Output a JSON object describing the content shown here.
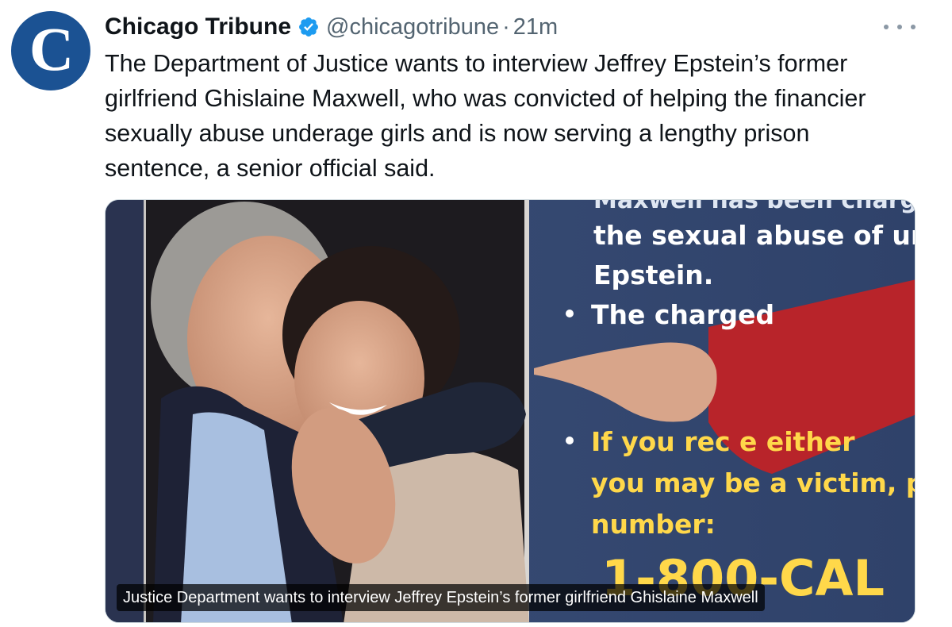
{
  "account": {
    "display_name": "Chicago Tribune",
    "handle": "@chicagotribune",
    "separator": "·",
    "time": "21m",
    "verified": true,
    "avatar_letter": "C",
    "avatar_color": "#1b5293",
    "verified_color": "#1d9bf0"
  },
  "tweet": {
    "text": "The Department of Justice wants to interview Jeffrey Epstein’s former\ngirlfriend Ghislaine Maxwell, who was convicted of helping the financier\nsexually abuse underage girls and is now serving a lengthy prison\nsentence, a senior official said."
  },
  "media": {
    "board_lines": [
      "Maxwell has been charg",
      "the sexual abuse of und",
      "Epstein.",
      "The charged",
      "If you rec      e either",
      "you may be a victim, pl",
      "number:",
      "1-800-CAL"
    ],
    "caption": "Justice Department wants to interview Jeffrey Epstein’s former girlfriend Ghislaine Maxwell"
  },
  "icons": {
    "more": "more-options-icon",
    "verified": "verified-badge-icon"
  }
}
